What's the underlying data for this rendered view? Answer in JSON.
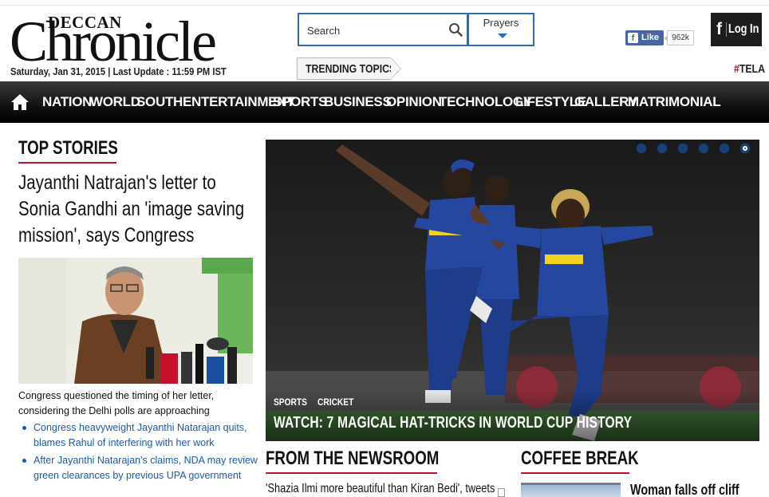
{
  "header": {
    "logo_small": "DECCAN",
    "logo_big": "Chronicle",
    "dateline": "Saturday, Jan 31, 2015 | Last Update : 11:59 PM IST",
    "search_placeholder": "Search",
    "prayers_label": "Prayers",
    "trending_label": "TRENDING TOPICS:",
    "facebook_like_label": "Like",
    "facebook_like_count": "962k",
    "login_icon": "f",
    "login_label": "Log In",
    "hashtag_symbol": "#",
    "hashtag_text": "TELA"
  },
  "nav": {
    "home_icon": "home-icon",
    "items": [
      "NATION",
      "WORLD",
      "SOUTH",
      "ENTERTAINMENT",
      "SPORTS",
      "BUSINESS",
      "OPINION",
      "TECHNOLOGY",
      "LIFESTYLE",
      "GALLERY",
      "MATRIMONIAL"
    ]
  },
  "top_stories": {
    "section_title": "TOP STORIES",
    "headline": "Jayanthi Natrajan's letter to Sonia Gandhi an 'image saving mission', says Congress",
    "caption": "Congress questioned the timing of her letter, considering the Delhi polls are approaching",
    "related": [
      "Congress heavyweight Jayanthi Natarajan quits, blames Rahul of interfering with her work",
      "After Jayanthi Natarajan's claims, NDA may review green clearances by previous UPA government"
    ]
  },
  "hero": {
    "tags": [
      "SPORTS",
      "CRICKET"
    ],
    "title": "WATCH: 7 MAGICAL HAT-TRICKS IN WORLD CUP HISTORY",
    "slide_count": 6,
    "active_slide": 6,
    "colors": {
      "dot": "#1c3f75",
      "jersey": "#2547a0",
      "jersey_yellow": "#f2d21e"
    }
  },
  "newsroom": {
    "section_title": "FROM THE NEWSROOM",
    "first_item": "'Shazia Ilmi more beautiful than Kiran Bedi', tweets"
  },
  "coffee_break": {
    "section_title": "COFFEE BREAK",
    "first_item": "Woman falls off cliff"
  },
  "colors": {
    "accent": "#c8102e",
    "link": "#1b5ba8",
    "border_blue": "#2a6db5",
    "nav_bg": "#111111"
  }
}
